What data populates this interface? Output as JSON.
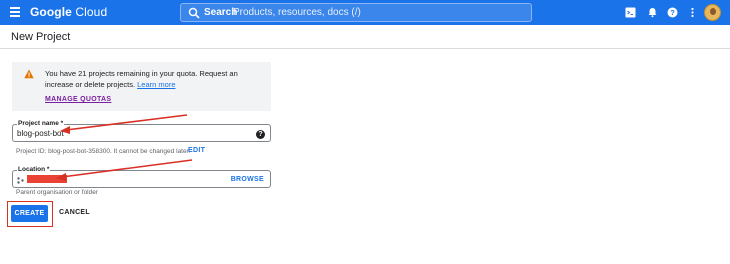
{
  "header": {
    "logo_bold": "Google",
    "logo_rest": " Cloud",
    "search_label": "Search",
    "search_placeholder": "Products, resources, docs (/)",
    "icons": [
      "menu-icon",
      "search-icon",
      "terminal-icon",
      "bell-icon",
      "help-icon",
      "more-vert-icon",
      "avatar"
    ]
  },
  "page": {
    "title": "New Project"
  },
  "quota": {
    "message": "You have 21 projects remaining in your quota. Request an increase or delete projects. ",
    "learn_more": "Learn more",
    "manage_label": "MANAGE QUOTAS"
  },
  "project_name": {
    "label": "Project name *",
    "value": "blog-post-bot",
    "id_text": "Project ID: blog-post-bot-358300. It cannot be changed later.",
    "edit_label": "EDIT"
  },
  "location": {
    "label": "Location *",
    "value": "",
    "browse_label": "BROWSE",
    "hint": "Parent organisation or folder"
  },
  "actions": {
    "create_label": "CREATE",
    "cancel_label": "CANCEL"
  },
  "colors": {
    "brand": "#1a73e8",
    "warning": "#e37400",
    "annotation": "#d93025"
  }
}
